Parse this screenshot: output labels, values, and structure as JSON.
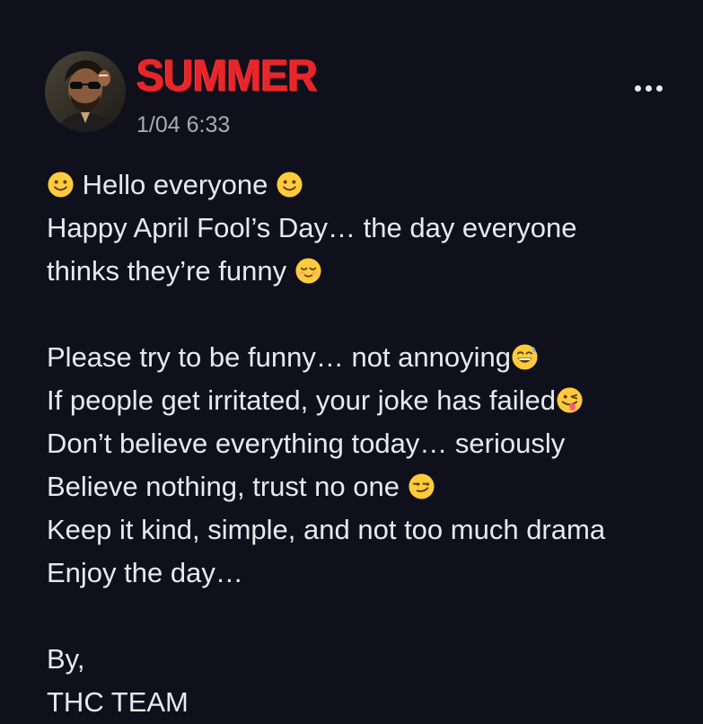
{
  "post": {
    "author": "SUMMER",
    "timestamp": "1/04 6:33",
    "author_color": "#e8262a",
    "background": "#0f101c",
    "more_icon": "more-horizontal-icon",
    "lines": [
      {
        "pre_emoji": "slightly-smiling-face",
        "text": "Hello everyone",
        "post_emoji": "slightly-smiling-face"
      },
      {
        "text": "Happy April Fool’s Day… the day everyone"
      },
      {
        "text": "thinks they’re funny",
        "post_emoji": "relieved-face"
      },
      {
        "text": ""
      },
      {
        "text": "Please try to be funny… not annoying",
        "post_emoji": "grinning-sweat-face"
      },
      {
        "text": "If people get irritated, your joke has failed",
        "post_emoji": "winking-tongue-face"
      },
      {
        "text": "Don’t believe everything today… seriously"
      },
      {
        "text": "Believe nothing, trust no one",
        "post_emoji": "smirking-face"
      },
      {
        "text": "Keep it kind, simple, and not too much drama"
      },
      {
        "text": "Enjoy the day…"
      },
      {
        "text": ""
      },
      {
        "text": "By,"
      },
      {
        "text": "THC TEAM"
      }
    ]
  }
}
